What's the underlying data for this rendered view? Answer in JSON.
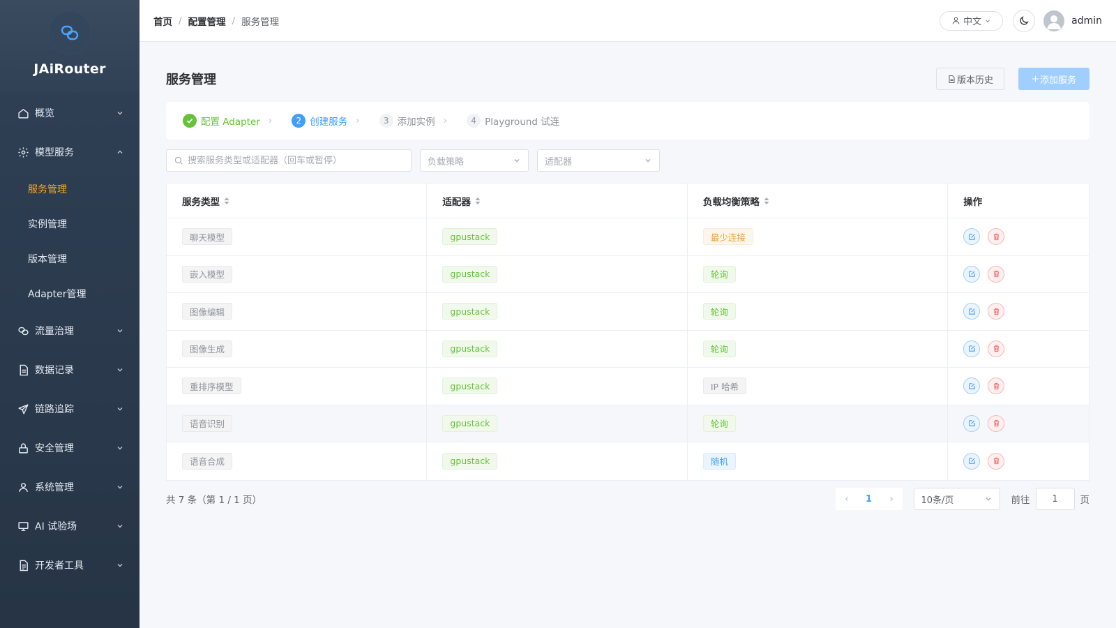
{
  "brand": {
    "name": "JAiRouter",
    "logo_icon": "link-logo-icon"
  },
  "sidebar": {
    "items": [
      {
        "label": "概览",
        "icon": "home-icon",
        "expanded": false
      },
      {
        "label": "模型服务",
        "icon": "gear-icon",
        "expanded": true,
        "children": [
          {
            "label": "服务管理",
            "active": true
          },
          {
            "label": "实例管理"
          },
          {
            "label": "版本管理"
          },
          {
            "label": "Adapter管理"
          }
        ]
      },
      {
        "label": "流量治理",
        "icon": "link-icon",
        "expanded": false
      },
      {
        "label": "数据记录",
        "icon": "document-icon",
        "expanded": false
      },
      {
        "label": "链路追踪",
        "icon": "send-icon",
        "expanded": false
      },
      {
        "label": "安全管理",
        "icon": "lock-icon",
        "expanded": false
      },
      {
        "label": "系统管理",
        "icon": "user-icon",
        "expanded": false
      },
      {
        "label": "AI 试验场",
        "icon": "monitor-icon",
        "expanded": false
      },
      {
        "label": "开发者工具",
        "icon": "file-icon",
        "expanded": false
      }
    ]
  },
  "header": {
    "breadcrumb": [
      "首页",
      "配置管理",
      "服务管理"
    ],
    "language": "中文",
    "username": "admin"
  },
  "page": {
    "title": "服务管理",
    "history_button": "版本历史",
    "add_button": "添加服务"
  },
  "steps": [
    {
      "num": "1",
      "label": "配置 Adapter",
      "state": "done"
    },
    {
      "num": "2",
      "label": "创建服务",
      "state": "active"
    },
    {
      "num": "3",
      "label": "添加实例",
      "state": "todo"
    },
    {
      "num": "4",
      "label": "Playground 试连",
      "state": "todo"
    }
  ],
  "filters": {
    "search_placeholder": "搜索服务类型或适配器（回车或暂停）",
    "strategy_placeholder": "负载策略",
    "adapter_placeholder": "适配器"
  },
  "table": {
    "columns": [
      "服务类型",
      "适配器",
      "负载均衡策略",
      "操作"
    ],
    "rows": [
      {
        "service": "聊天模型",
        "adapter": "gpustack",
        "strategy": "最少连接",
        "strategy_color": "orange"
      },
      {
        "service": "嵌入模型",
        "adapter": "gpustack",
        "strategy": "轮询",
        "strategy_color": "green"
      },
      {
        "service": "图像编辑",
        "adapter": "gpustack",
        "strategy": "轮询",
        "strategy_color": "green"
      },
      {
        "service": "图像生成",
        "adapter": "gpustack",
        "strategy": "轮询",
        "strategy_color": "green"
      },
      {
        "service": "重排序模型",
        "adapter": "gpustack",
        "strategy": "IP 哈希",
        "strategy_color": "gray"
      },
      {
        "service": "语音识别",
        "adapter": "gpustack",
        "strategy": "轮询",
        "strategy_color": "green",
        "hover": true
      },
      {
        "service": "语音合成",
        "adapter": "gpustack",
        "strategy": "随机",
        "strategy_color": "blue"
      }
    ]
  },
  "pagination": {
    "total_text": "共 7 条（第 1 / 1 页）",
    "current_page": "1",
    "page_size": "10条/页",
    "goto_label": "前往",
    "goto_value": "1",
    "page_suffix": "页"
  },
  "colors": {
    "sidebar_bg": "#304156",
    "active_menu": "#f5a623",
    "primary": "#409eff",
    "success": "#67c23a",
    "warning": "#e6a23c",
    "danger": "#f56c6c"
  }
}
